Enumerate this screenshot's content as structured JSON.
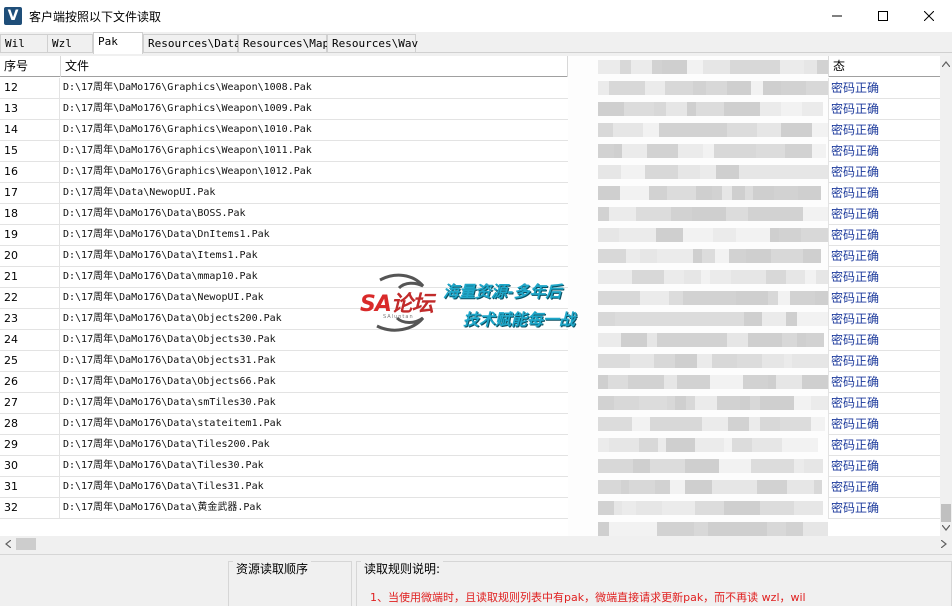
{
  "window": {
    "title": "客户端按照以下文件读取",
    "icon_letter": "V"
  },
  "tabs": [
    {
      "label": "Wil",
      "active": false
    },
    {
      "label": "Wzl",
      "active": false
    },
    {
      "label": "Pak",
      "active": true
    },
    {
      "label": "Resources\\Data",
      "active": false
    },
    {
      "label": "Resources\\Map",
      "active": false
    },
    {
      "label": "Resources\\Wav",
      "active": false
    }
  ],
  "table": {
    "headers": {
      "seq": "序号",
      "file": "文件",
      "status": "态"
    },
    "rows": [
      {
        "seq": "12",
        "file": "D:\\17周年\\DaMo176\\Graphics\\Weapon\\1008.Pak",
        "status": "密码正确"
      },
      {
        "seq": "13",
        "file": "D:\\17周年\\DaMo176\\Graphics\\Weapon\\1009.Pak",
        "status": "密码正确"
      },
      {
        "seq": "14",
        "file": "D:\\17周年\\DaMo176\\Graphics\\Weapon\\1010.Pak",
        "status": "密码正确"
      },
      {
        "seq": "15",
        "file": "D:\\17周年\\DaMo176\\Graphics\\Weapon\\1011.Pak",
        "status": "密码正确"
      },
      {
        "seq": "16",
        "file": "D:\\17周年\\DaMo176\\Graphics\\Weapon\\1012.Pak",
        "status": "密码正确"
      },
      {
        "seq": "17",
        "file": "D:\\17周年\\Data\\NewopUI.Pak",
        "status": "密码正确"
      },
      {
        "seq": "18",
        "file": "D:\\17周年\\DaMo176\\Data\\BOSS.Pak",
        "status": "密码正确"
      },
      {
        "seq": "19",
        "file": "D:\\17周年\\DaMo176\\Data\\DnItems1.Pak",
        "status": "密码正确"
      },
      {
        "seq": "20",
        "file": "D:\\17周年\\DaMo176\\Data\\Items1.Pak",
        "status": "密码正确"
      },
      {
        "seq": "21",
        "file": "D:\\17周年\\DaMo176\\Data\\mmap10.Pak",
        "status": "密码正确"
      },
      {
        "seq": "22",
        "file": "D:\\17周年\\DaMo176\\Data\\NewopUI.Pak",
        "status": "密码正确"
      },
      {
        "seq": "23",
        "file": "D:\\17周年\\DaMo176\\Data\\Objects200.Pak",
        "status": "密码正确"
      },
      {
        "seq": "24",
        "file": "D:\\17周年\\DaMo176\\Data\\Objects30.Pak",
        "status": "密码正确"
      },
      {
        "seq": "25",
        "file": "D:\\17周年\\DaMo176\\Data\\Objects31.Pak",
        "status": "密码正确"
      },
      {
        "seq": "26",
        "file": "D:\\17周年\\DaMo176\\Data\\Objects66.Pak",
        "status": "密码正确"
      },
      {
        "seq": "27",
        "file": "D:\\17周年\\DaMo176\\Data\\smTiles30.Pak",
        "status": "密码正确"
      },
      {
        "seq": "28",
        "file": "D:\\17周年\\DaMo176\\Data\\stateitem1.Pak",
        "status": "密码正确"
      },
      {
        "seq": "29",
        "file": "D:\\17周年\\DaMo176\\Data\\Tiles200.Pak",
        "status": "密码正确"
      },
      {
        "seq": "30",
        "file": "D:\\17周年\\DaMo176\\Data\\Tiles30.Pak",
        "status": "密码正确"
      },
      {
        "seq": "31",
        "file": "D:\\17周年\\DaMo176\\Data\\Tiles31.Pak",
        "status": "密码正确"
      },
      {
        "seq": "32",
        "file": "D:\\17周年\\DaMo176\\Data\\黄金武器.Pak",
        "status": "密码正确"
      }
    ]
  },
  "bottom": {
    "order_title": "资源读取顺序",
    "rules_title": "读取规则说明:",
    "rule_1": "1、当使用微端时，且读取规则列表中有pak，微端直接请求更新pak，而不再读 wzl，wil"
  },
  "watermark": {
    "logo_a": "SA",
    "logo_b": "论坛",
    "logo_sub": "SAluntan",
    "line1": "海量资源-多年后",
    "line2": "技术赋能每一战"
  },
  "colors": {
    "status_text": "#1c3a9c",
    "rule_text": "#e02020",
    "watermark_accent": "#1fa7c9",
    "logo_red": "#d92a2a"
  }
}
